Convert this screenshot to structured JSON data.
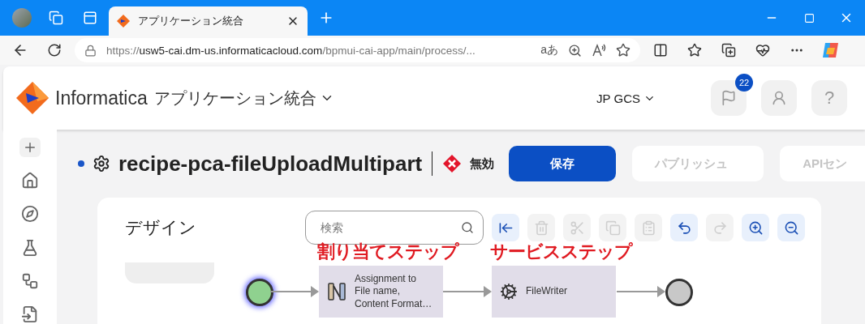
{
  "browser": {
    "tabs": [
      {
        "title": "アプリケーション統合",
        "selected": true
      }
    ],
    "url": {
      "scheme": "https://",
      "host": "usw5-cai.dm-us.informaticacloud.com",
      "path": "/bpmui-cai-app/main/process/..."
    },
    "translate_label": "aあ"
  },
  "header": {
    "brand": "Informatica",
    "product": "アプリケーション統合",
    "org": "JP GCS",
    "notifications": "22",
    "help": "?"
  },
  "process": {
    "title": "recipe-pca-fileUploadMultipart",
    "unsaved": true,
    "status": {
      "label": "無効",
      "valid": false
    },
    "actions": [
      {
        "label": "保存",
        "kind": "primary",
        "disabled": false
      },
      {
        "label": "パブリッシュ",
        "kind": "secondary",
        "disabled": true
      },
      {
        "label": "APIセン",
        "kind": "secondary",
        "disabled": true
      }
    ]
  },
  "design": {
    "title": "デザイン",
    "search": {
      "placeholder": "検索"
    },
    "tools": [
      {
        "kind": "collapse",
        "disabled": false
      },
      {
        "kind": "delete",
        "disabled": true
      },
      {
        "kind": "cut",
        "disabled": true
      },
      {
        "kind": "copy",
        "disabled": true
      },
      {
        "kind": "paste",
        "disabled": true
      },
      {
        "kind": "undo",
        "disabled": false
      },
      {
        "kind": "redo",
        "disabled": true
      },
      {
        "kind": "zoom-in",
        "disabled": false
      },
      {
        "kind": "zoom-out",
        "disabled": false
      }
    ],
    "nodes": [
      {
        "kind": "start"
      },
      {
        "kind": "assignment",
        "text": "Assignment to File name, Content Format…",
        "annotation": "割り当てステップ"
      },
      {
        "kind": "service",
        "text": "FileWriter",
        "annotation": "サービスステップ"
      },
      {
        "kind": "end"
      }
    ]
  }
}
